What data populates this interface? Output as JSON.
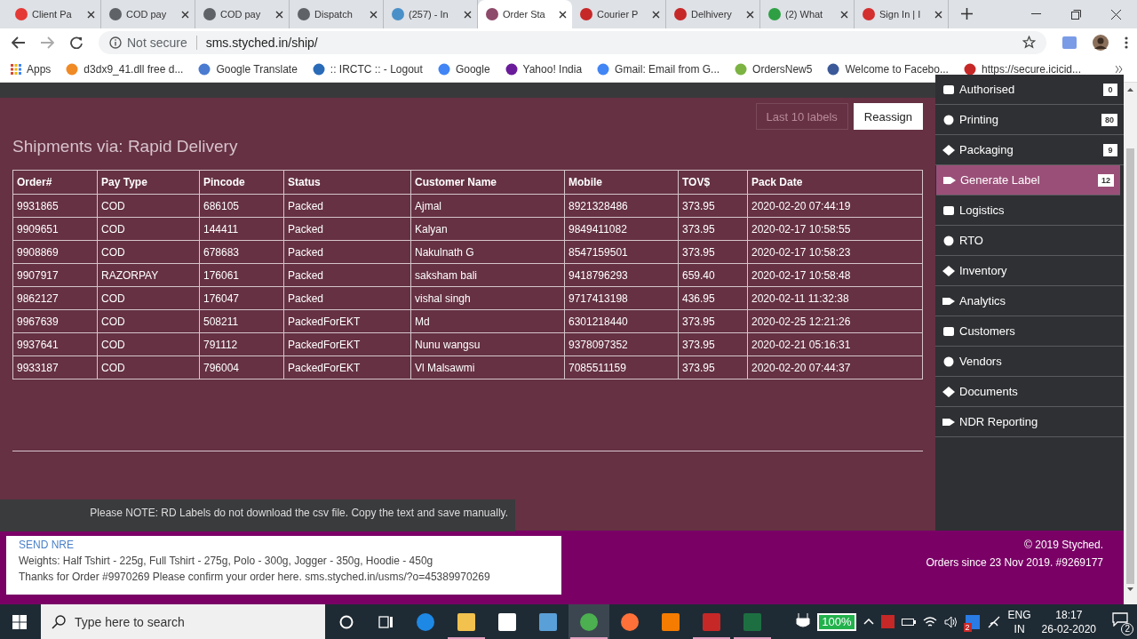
{
  "browser": {
    "tabs": [
      {
        "title": "Client Pa",
        "selected": false
      },
      {
        "title": "COD pay",
        "selected": false
      },
      {
        "title": "COD pay",
        "selected": false
      },
      {
        "title": "Dispatch",
        "selected": false
      },
      {
        "title": "(257) - In",
        "selected": false
      },
      {
        "title": "Order Sta",
        "selected": true
      },
      {
        "title": "Courier P",
        "selected": false
      },
      {
        "title": "Delhivery",
        "selected": false
      },
      {
        "title": "(2) What",
        "selected": false
      },
      {
        "title": "Sign In | I",
        "selected": false
      }
    ],
    "security": "Not secure",
    "url": "sms.styched.in/ship/",
    "bookmarks": [
      "Apps",
      "d3dx9_41.dll free d...",
      "Google Translate",
      ":: IRCTC :: - Logout",
      "Google",
      "Yahoo! India",
      "Gmail: Email from G...",
      "OrdersNew5",
      "Welcome to Facebo...",
      "https://secure.icicid..."
    ]
  },
  "page": {
    "buttons": [
      {
        "label": "Last 10 labels",
        "disabled": true
      },
      {
        "label": "Reassign",
        "disabled": false
      }
    ],
    "heading": "Shipments via: Rapid Delivery",
    "table": {
      "columns": [
        "Order#",
        "Pay Type",
        "Pincode",
        "Status",
        "Customer Name",
        "Mobile",
        "TOV$",
        "Pack Date"
      ],
      "rows": [
        [
          "9931865",
          "COD",
          "686105",
          "Packed",
          "Ajmal",
          "8921328486",
          "373.95",
          "2020-02-20 07:44:19"
        ],
        [
          "9909651",
          "COD",
          "144411",
          "Packed",
          "Kalyan",
          "9849411082",
          "373.95",
          "2020-02-17 10:58:55"
        ],
        [
          "9908869",
          "COD",
          "678683",
          "Packed",
          "Nakulnath G",
          "8547159501",
          "373.95",
          "2020-02-17 10:58:23"
        ],
        [
          "9907917",
          "RAZORPAY",
          "176061",
          "Packed",
          "saksham bali",
          "9418796293",
          "659.40",
          "2020-02-17 10:58:48"
        ],
        [
          "9862127",
          "COD",
          "176047",
          "Packed",
          "vishal singh",
          "9717413198",
          "436.95",
          "2020-02-11 11:32:38"
        ],
        [
          "9967639",
          "COD",
          "508211",
          "PackedForEKT",
          "Md",
          "6301218440",
          "373.95",
          "2020-02-25 12:21:26"
        ],
        [
          "9937641",
          "COD",
          "791112",
          "PackedForEKT",
          "Nunu wangsu",
          "9378097352",
          "373.95",
          "2020-02-21 05:16:31"
        ],
        [
          "9933187",
          "COD",
          "796004",
          "PackedForEKT",
          "Vl Malsawmi",
          "7085511159",
          "373.95",
          "2020-02-20 07:44:37"
        ]
      ]
    },
    "note": "Please NOTE: RD Labels do not download the csv file. Copy the text and save manually.",
    "popup": {
      "link": "SEND NRE",
      "lines": [
        "Weights: Half Tshirt - 225g, Full Tshirt - 275g, Polo - 300g, Jogger - 350g, Hoodie - 450g",
        "Thanks for Order #9970269 Please confirm your order here. sms.styched.in/usms/?o=45389970269"
      ]
    },
    "footer": [
      "© 2019 Styched.",
      "Orders since 23 Nov 2019. #9269177"
    ]
  },
  "sidebar": {
    "items": [
      {
        "label": "Authorised",
        "badge": "0",
        "selected": false
      },
      {
        "label": "Printing",
        "badge": "80",
        "selected": false
      },
      {
        "label": "Packaging",
        "badge": "9",
        "selected": false
      },
      {
        "label": "Generate Label",
        "badge": "12",
        "selected": true
      },
      {
        "label": "Logistics",
        "selected": false
      },
      {
        "label": "RTO",
        "selected": false
      },
      {
        "label": "Inventory",
        "selected": false
      },
      {
        "label": "Analytics",
        "selected": false
      },
      {
        "label": "Customers",
        "selected": false
      },
      {
        "label": "Vendors",
        "selected": false
      },
      {
        "label": "Documents",
        "selected": false
      },
      {
        "label": "NDR Reporting",
        "selected": false
      }
    ]
  },
  "taskbar": {
    "search_placeholder": "Type here to search",
    "apps": [
      {
        "running": false,
        "selected": false
      },
      {
        "running": true,
        "selected": false
      },
      {
        "running": false,
        "selected": false
      },
      {
        "running": false,
        "selected": false
      },
      {
        "running": true,
        "selected": true
      },
      {
        "running": false,
        "selected": false
      },
      {
        "running": false,
        "selected": false
      },
      {
        "running": true,
        "selected": false
      },
      {
        "running": true,
        "selected": false
      }
    ],
    "battery": "100%",
    "dropbox_badge": "2",
    "language": [
      "ENG",
      "IN"
    ],
    "time": "18:17",
    "date": "26-02-2020",
    "notifications": "2"
  }
}
